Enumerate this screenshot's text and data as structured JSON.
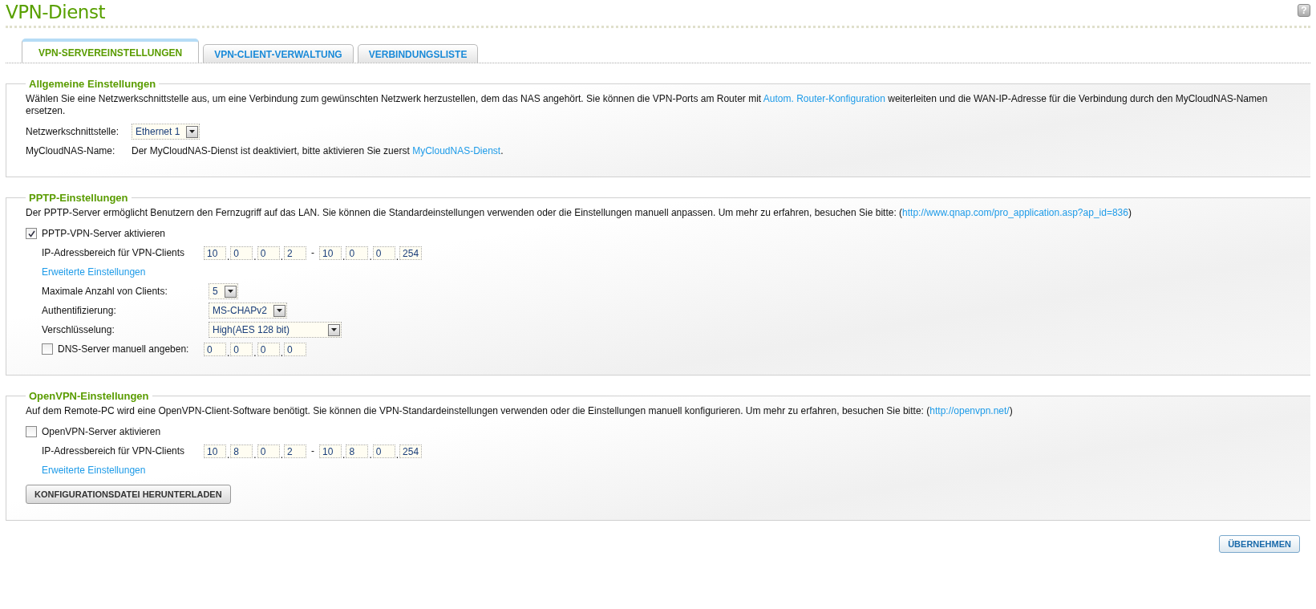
{
  "page_title": "VPN-Dienst",
  "help": "?",
  "tabs": [
    {
      "label": "VPN-SERVEREINSTELLUNGEN",
      "selected": true
    },
    {
      "label": "VPN-CLIENT-VERWALTUNG",
      "selected": false
    },
    {
      "label": "VERBINDUNGSLISTE",
      "selected": false
    }
  ],
  "sections": [
    {
      "title": "Allgemeine Einstellungen",
      "description": [
        {
          "kind": "text",
          "text": "Wählen Sie eine Netzwerkschnittstelle aus, um eine Verbindung zum gewünschten Netzwerk herzustellen, dem das NAS angehört. Sie können die VPN-Ports am Router mit "
        },
        {
          "kind": "link",
          "text": "Autom. Router-Konfiguration"
        },
        {
          "kind": "text",
          "text": " weiterleiten und die WAN-IP-Adresse für die Verbindung durch den MyCloudNAS-Namen ersetzen."
        }
      ],
      "rows": [
        {
          "kind": "select",
          "label": "Netzwerkschnittstelle:",
          "value": "Ethernet 1"
        },
        {
          "kind": "info",
          "label": "MyCloudNAS-Name:",
          "parts": [
            {
              "kind": "text",
              "text": "Der MyCloudNAS-Dienst ist deaktiviert, bitte aktivieren Sie zuerst "
            },
            {
              "kind": "link",
              "text": "MyCloudNAS-Dienst"
            },
            {
              "kind": "text",
              "text": "."
            }
          ]
        }
      ]
    },
    {
      "title": "PPTP-Einstellungen",
      "description": [
        {
          "kind": "text",
          "text": "Der PPTP-Server ermöglicht Benutzern den Fernzugriff auf das LAN. Sie können die Standardeinstellungen verwenden oder die Einstellungen manuell anpassen. Um mehr zu erfahren, besuchen Sie bitte: ("
        },
        {
          "kind": "link",
          "text": "http://www.qnap.com/pro_application.asp?ap_id=836"
        },
        {
          "kind": "text",
          "text": ")"
        }
      ],
      "rows": [
        {
          "kind": "checkbox",
          "label": "PPTP-VPN-Server aktivieren",
          "checked": true,
          "children": [
            {
              "kind": "ip_range",
              "label": "IP-Adressbereich für VPN-Clients",
              "from": [
                "10",
                "0",
                "0",
                "2"
              ],
              "dot": ".",
              "separator": "-",
              "to": [
                "10",
                "0",
                "0",
                "254"
              ]
            },
            {
              "kind": "link",
              "text": "Erweiterte Einstellungen"
            },
            {
              "kind": "select",
              "label": "Maximale Anzahl von Clients:",
              "value": "5"
            },
            {
              "kind": "select",
              "label": "Authentifizierung:",
              "value": "MS-CHAPv2"
            },
            {
              "kind": "select",
              "label": "Verschlüsselung:",
              "value": "High(AES 128 bit)",
              "wide": true
            },
            {
              "kind": "checkbox_ip",
              "label": "DNS-Server manuell angeben:",
              "checked": false,
              "address": [
                "0",
                "0",
                "0",
                "0"
              ],
              "dot": "."
            }
          ]
        }
      ]
    },
    {
      "title": "OpenVPN-Einstellungen",
      "description": [
        {
          "kind": "text",
          "text": "Auf dem Remote-PC wird eine OpenVPN-Client-Software benötigt. Sie können die VPN-Standardeinstellungen verwenden oder die Einstellungen manuell konfigurieren. Um mehr zu erfahren, besuchen Sie bitte: ("
        },
        {
          "kind": "link",
          "text": "http://openvpn.net/"
        },
        {
          "kind": "text",
          "text": ")"
        }
      ],
      "rows": [
        {
          "kind": "checkbox",
          "label": "OpenVPN-Server aktivieren",
          "checked": false,
          "children": [
            {
              "kind": "ip_range",
              "label": "IP-Adressbereich für VPN-Clients",
              "from": [
                "10",
                "8",
                "0",
                "2"
              ],
              "dot": ".",
              "separator": "-",
              "to": [
                "10",
                "8",
                "0",
                "254"
              ]
            },
            {
              "kind": "link",
              "text": "Erweiterte Einstellungen"
            }
          ]
        },
        {
          "kind": "button",
          "text": "KONFIGURATIONSDATEI HERUNTERLADEN"
        }
      ]
    }
  ],
  "apply_button": "ÜBERNEHMEN"
}
